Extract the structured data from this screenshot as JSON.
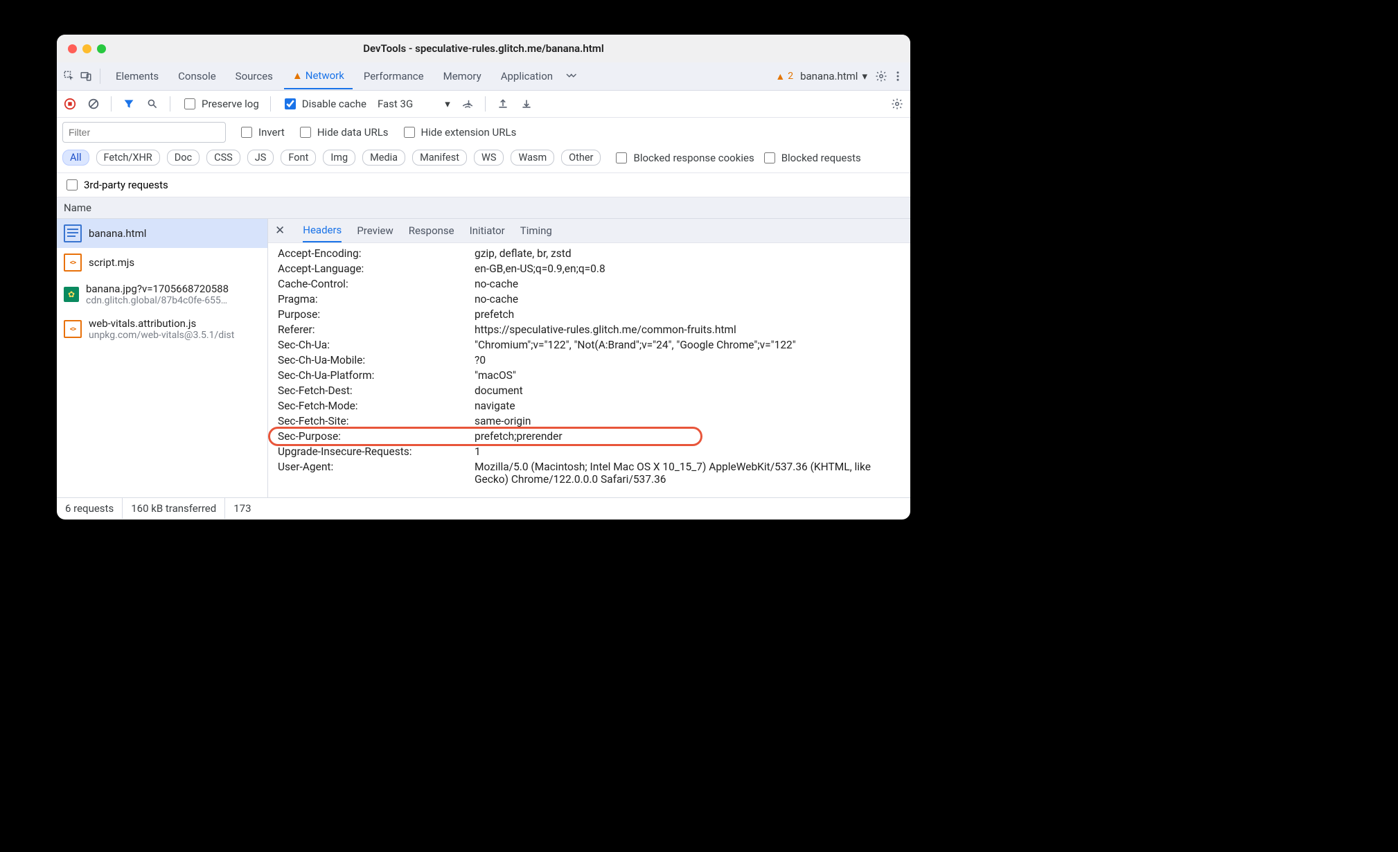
{
  "window": {
    "title": "DevTools - speculative-rules.glitch.me/banana.html"
  },
  "topTabs": {
    "elements": "Elements",
    "console": "Console",
    "sources": "Sources",
    "network": "Network",
    "performance": "Performance",
    "memory": "Memory",
    "application": "Application"
  },
  "warning_count": "2",
  "context": "banana.html",
  "toolbar": {
    "preserve": "Preserve log",
    "disable": "Disable cache",
    "throttle": "Fast 3G"
  },
  "filter": {
    "placeholder": "Filter",
    "invert": "Invert",
    "hideData": "Hide data URLs",
    "hideExt": "Hide extension URLs"
  },
  "types": [
    "All",
    "Fetch/XHR",
    "Doc",
    "CSS",
    "JS",
    "Font",
    "Img",
    "Media",
    "Manifest",
    "WS",
    "Wasm",
    "Other"
  ],
  "blk_resp": "Blocked response cookies",
  "blk_req": "Blocked requests",
  "third": "3rd-party requests",
  "colhead": "Name",
  "requests": [
    {
      "name": "banana.html",
      "sub": "",
      "icon": "doc",
      "sel": true
    },
    {
      "name": "script.mjs",
      "sub": "",
      "icon": "js",
      "sel": false
    },
    {
      "name": "banana.jpg?v=1705668720588",
      "sub": "cdn.glitch.global/87b4c0fe-655…",
      "icon": "img",
      "sel": false
    },
    {
      "name": "web-vitals.attribution.js",
      "sub": "unpkg.com/web-vitals@3.5.1/dist",
      "icon": "js",
      "sel": false
    }
  ],
  "detTabs": {
    "headers": "Headers",
    "preview": "Preview",
    "response": "Response",
    "initiator": "Initiator",
    "timing": "Timing"
  },
  "headers": [
    {
      "k": "Accept-Encoding:",
      "v": "gzip, deflate, br, zstd"
    },
    {
      "k": "Accept-Language:",
      "v": "en-GB,en-US;q=0.9,en;q=0.8"
    },
    {
      "k": "Cache-Control:",
      "v": "no-cache"
    },
    {
      "k": "Pragma:",
      "v": "no-cache"
    },
    {
      "k": "Purpose:",
      "v": "prefetch"
    },
    {
      "k": "Referer:",
      "v": "https://speculative-rules.glitch.me/common-fruits.html"
    },
    {
      "k": "Sec-Ch-Ua:",
      "v": "\"Chromium\";v=\"122\", \"Not(A:Brand\";v=\"24\", \"Google Chrome\";v=\"122\""
    },
    {
      "k": "Sec-Ch-Ua-Mobile:",
      "v": "?0"
    },
    {
      "k": "Sec-Ch-Ua-Platform:",
      "v": "\"macOS\""
    },
    {
      "k": "Sec-Fetch-Dest:",
      "v": "document"
    },
    {
      "k": "Sec-Fetch-Mode:",
      "v": "navigate"
    },
    {
      "k": "Sec-Fetch-Site:",
      "v": "same-origin"
    },
    {
      "k": "Sec-Purpose:",
      "v": "prefetch;prerender",
      "hl": true
    },
    {
      "k": "Upgrade-Insecure-Requests:",
      "v": "1"
    },
    {
      "k": "User-Agent:",
      "v": "Mozilla/5.0 (Macintosh; Intel Mac OS X 10_15_7) AppleWebKit/537.36 (KHTML, like Gecko) Chrome/122.0.0.0 Safari/537.36"
    }
  ],
  "status": {
    "requests": "6 requests",
    "transfer": "160 kB transferred",
    "more": "173"
  }
}
